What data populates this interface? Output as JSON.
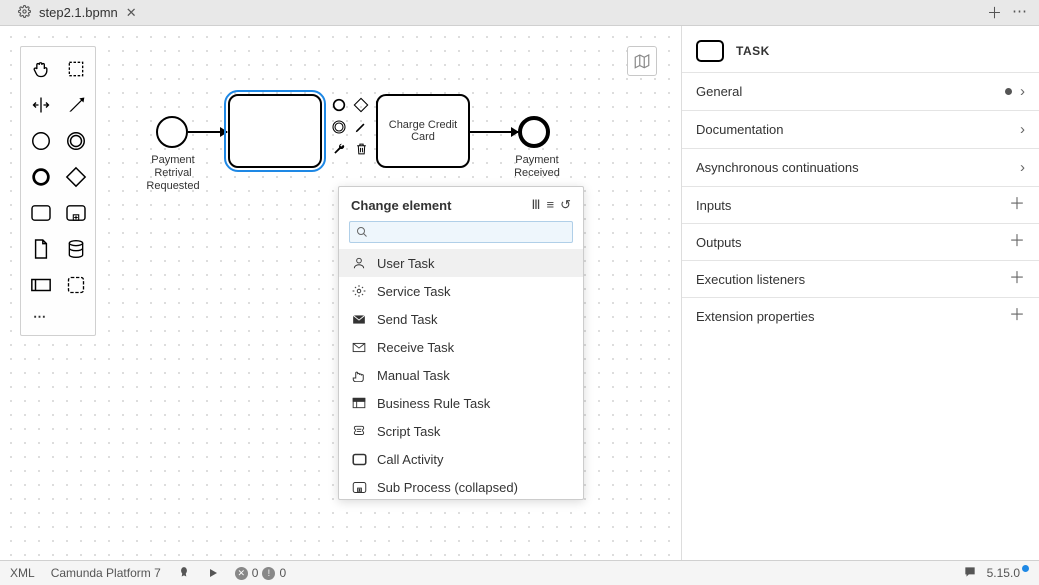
{
  "tab": {
    "file": "step2.1.bpmn"
  },
  "palette_tools": [
    "hand-tool",
    "lasso-tool",
    "space-tool",
    "connect-tool",
    "start-event",
    "start-event-alt",
    "intermediate-event",
    "gateway",
    "task",
    "subprocess-expanded",
    "data-object",
    "data-store",
    "participant",
    "group"
  ],
  "diagram": {
    "start_label": "Payment Retrival Requested",
    "task1_label": "",
    "task2_label": "Charge Credit Card",
    "end_label": "Payment Received"
  },
  "popup": {
    "title": "Change element",
    "search_placeholder": "",
    "items": [
      {
        "icon": "user-task",
        "label": "User Task"
      },
      {
        "icon": "service-task",
        "label": "Service Task"
      },
      {
        "icon": "send-task",
        "label": "Send Task"
      },
      {
        "icon": "receive-task",
        "label": "Receive Task"
      },
      {
        "icon": "manual-task",
        "label": "Manual Task"
      },
      {
        "icon": "business-rule-task",
        "label": "Business Rule Task"
      },
      {
        "icon": "script-task",
        "label": "Script Task"
      },
      {
        "icon": "call-activity",
        "label": "Call Activity"
      },
      {
        "icon": "subprocess",
        "label": "Sub Process (collapsed)"
      }
    ]
  },
  "props": {
    "title": "TASK",
    "sections": [
      {
        "label": "General",
        "ctl": "dot-arrow"
      },
      {
        "label": "Documentation",
        "ctl": "arrow"
      },
      {
        "label": "Asynchronous continuations",
        "ctl": "arrow"
      },
      {
        "label": "Inputs",
        "ctl": "plus"
      },
      {
        "label": "Outputs",
        "ctl": "plus"
      },
      {
        "label": "Execution listeners",
        "ctl": "plus"
      },
      {
        "label": "Extension properties",
        "ctl": "plus"
      }
    ]
  },
  "footer": {
    "xml": "XML",
    "engine": "Camunda Platform 7",
    "err_count": "0",
    "warn_count": "0",
    "version": "5.15.0"
  }
}
